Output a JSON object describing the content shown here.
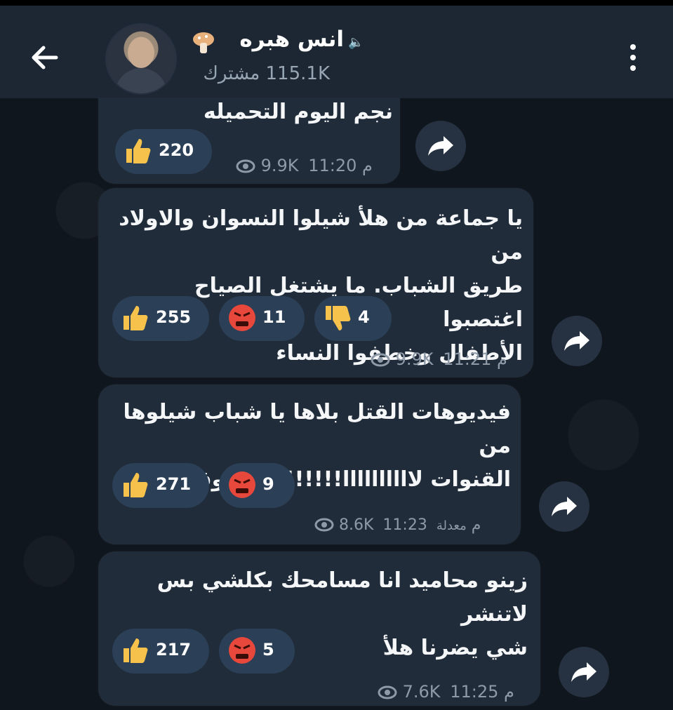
{
  "header": {
    "channel_name": "انس هبره",
    "subscribers": "115.1K مشترك"
  },
  "messages": [
    {
      "text_lines": [
        "نجم اليوم التحميله"
      ],
      "reactions": [
        {
          "emoji": "thumbs-up",
          "count": "220"
        }
      ],
      "views": "9.9K",
      "time": "11:20 م",
      "edited": ""
    },
    {
      "text_lines": [
        "يا جماعة من هلأ شيلوا النسوان والاولاد من",
        "طريق الشباب. ما يشتغل الصياح اغتصبوا",
        "الأطفال وخطفوا النساء"
      ],
      "reactions": [
        {
          "emoji": "thumbs-up",
          "count": "255"
        },
        {
          "emoji": "angry-face",
          "count": "11"
        },
        {
          "emoji": "thumbs-down",
          "count": "4"
        }
      ],
      "views": "9.9K",
      "time": "11:21 م",
      "edited": ""
    },
    {
      "text_lines": [
        "فيديوهات القتل بلاها يا شباب شيلوها من",
        "القنوات لاااااااااا!!!!!!!! مو وقتها هلأ"
      ],
      "reactions": [
        {
          "emoji": "thumbs-up",
          "count": "271"
        },
        {
          "emoji": "angry-face",
          "count": "9"
        }
      ],
      "views": "8.6K",
      "time": "11:23 م",
      "edited": "معدلة"
    },
    {
      "text_lines": [
        "زينو محاميد انا مسامحك بكلشي بس لاتنشر",
        "شي يضرنا هلأ"
      ],
      "reactions": [
        {
          "emoji": "thumbs-up",
          "count": "217"
        },
        {
          "emoji": "angry-face",
          "count": "5"
        }
      ],
      "views": "7.6K",
      "time": "11:25 م",
      "edited": ""
    }
  ],
  "colors": {
    "background": "#10161d",
    "header": "#1d2733",
    "bubble": "#202c39",
    "reaction": "#2b3f57",
    "meta": "#8e9aa8"
  }
}
